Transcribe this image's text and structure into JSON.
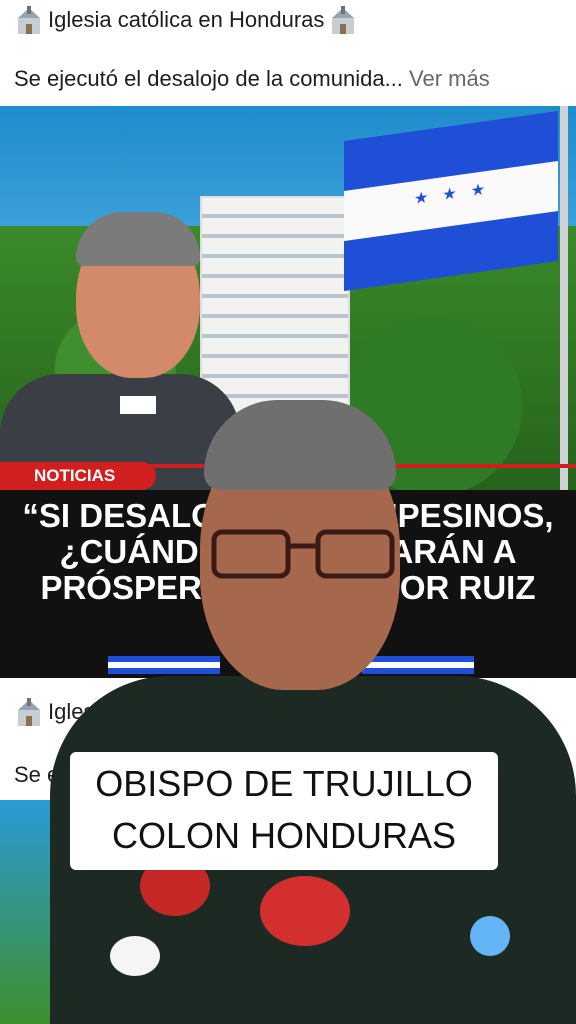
{
  "post1": {
    "page_name": "Iglesia católica en Honduras",
    "caption": "Se ejecutó el desalojo de la comunida...",
    "see_more": " Ver más",
    "thumbnail": {
      "tag": "NOTICIAS",
      "headline": "“SI DESALOJAN A CAMPESINOS,\n¿CUÁNDO DESALOJARÁN A\nPRÓSPERA? MONSEÑOR RUIZ\nA."
    }
  },
  "post2": {
    "page_name": "Iglesia católica en Honduras",
    "caption": "Se e"
  },
  "overlay": {
    "text": "OBISPO DE TRUJILLO\nCOLON HONDURAS"
  },
  "colors": {
    "banner_red": "#d11f1f",
    "flag_blue": "#1e4fd6"
  },
  "icons": [
    "church-icon"
  ]
}
